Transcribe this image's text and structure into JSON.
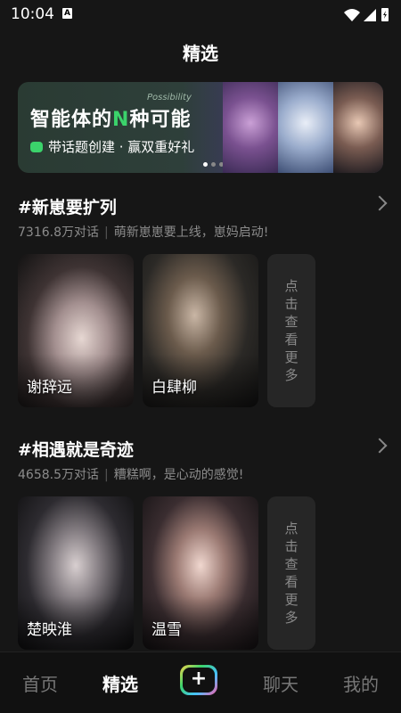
{
  "status_bar": {
    "time": "10:04",
    "badge": "A"
  },
  "page": {
    "title": "精选"
  },
  "banner": {
    "headline_prefix": "智能体的",
    "headline_highlight": "N",
    "headline_suffix": "种可能",
    "tiny_text": "Possibility",
    "subline": "带话题创建 · 赢双重好礼",
    "accent_color": "#3bd36b"
  },
  "sections": [
    {
      "title": "#新崽要扩列",
      "stats": "7316.8万对话",
      "desc": "萌新崽崽要上线，崽妈启动!",
      "cards": [
        {
          "name": "谢辞远"
        },
        {
          "name": "白肆柳"
        }
      ],
      "more": [
        "点",
        "击",
        "查",
        "看",
        "更",
        "多"
      ]
    },
    {
      "title": "#相遇就是奇迹",
      "stats": "4658.5万对话",
      "desc": "糟糕啊，是心动的感觉!",
      "cards": [
        {
          "name": "楚映淮"
        },
        {
          "name": "温雪"
        }
      ],
      "more": [
        "点",
        "击",
        "查",
        "看",
        "更",
        "多"
      ]
    }
  ],
  "nav": {
    "home": "首页",
    "featured": "精选",
    "create": "+",
    "chat": "聊天",
    "mine": "我的"
  }
}
